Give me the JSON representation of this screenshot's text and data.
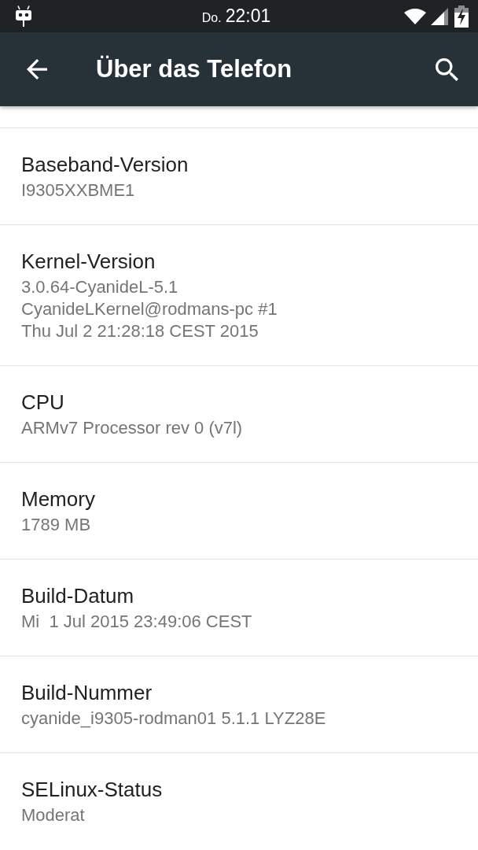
{
  "status_bar": {
    "day": "Do.",
    "time": "22:01"
  },
  "app_bar": {
    "title": "Über das Telefon"
  },
  "items": [
    {
      "title": "Baseband-Version",
      "summary": "I9305XXBME1"
    },
    {
      "title": "Kernel-Version",
      "summary": "3.0.64-CyanideL-5.1\nCyanideLKernel@rodmans-pc #1\nThu Jul 2 21:28:18 CEST 2015"
    },
    {
      "title": "CPU",
      "summary": "ARMv7 Processor rev 0 (v7l)"
    },
    {
      "title": "Memory",
      "summary": "1789 MB"
    },
    {
      "title": "Build-Datum",
      "summary": "Mi  1 Jul 2015 23:49:06 CEST"
    },
    {
      "title": "Build-Nummer",
      "summary": "cyanide_i9305-rodman01 5.1.1 LYZ28E"
    },
    {
      "title": "SELinux-Status",
      "summary": "Moderat"
    }
  ]
}
